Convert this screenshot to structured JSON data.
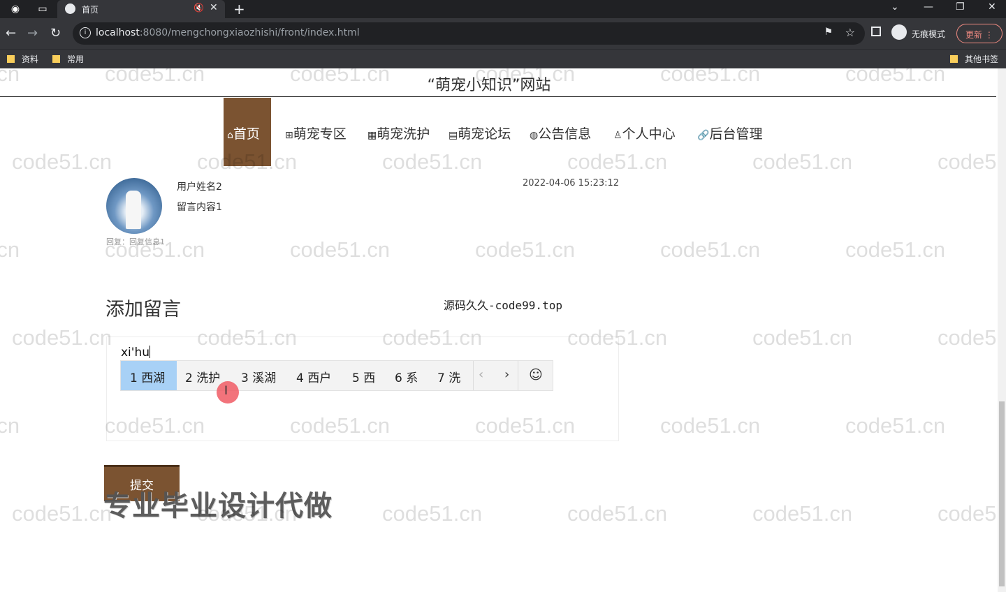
{
  "browser": {
    "tab_title": "首页",
    "url_host": "localhost",
    "url_rest": ":8080/mengchongxiaozhishi/front/index.html",
    "incognito_label": "无痕模式",
    "update_label": "更新",
    "bookmarks": [
      "资料",
      "常用"
    ],
    "other_bookmarks": "其他书签"
  },
  "site": {
    "title": "“萌宠小知识”网站",
    "nav": [
      {
        "icon": "⌂",
        "label": "首页",
        "active": true
      },
      {
        "icon": "⊞",
        "label": "萌宠专区"
      },
      {
        "icon": "▦",
        "label": "萌宠洗护"
      },
      {
        "icon": "▤",
        "label": "萌宠论坛"
      },
      {
        "icon": "◍",
        "label": "公告信息"
      },
      {
        "icon": "♙",
        "label": "个人中心"
      },
      {
        "icon": "🔗",
        "label": "后台管理"
      }
    ]
  },
  "message": {
    "username": "用户姓名2",
    "content": "留言内容1",
    "time": "2022-04-06 15:23:12",
    "reply": "回复：回复信息1"
  },
  "add_message": {
    "title": "添加留言",
    "input_value": "xi'hu",
    "submit_label": "提交"
  },
  "ime": {
    "candidates": [
      "1 西湖",
      "2 洗护",
      "3 溪湖",
      "4 西户",
      "5 西",
      "6 系",
      "7 洗"
    ],
    "prev": "‹",
    "next": "›",
    "emoji": "☺"
  },
  "overlay": {
    "site_watermark": "源码久久-code99.top",
    "promo": "专业毕业设计代做",
    "watermark": "code51.cn"
  }
}
